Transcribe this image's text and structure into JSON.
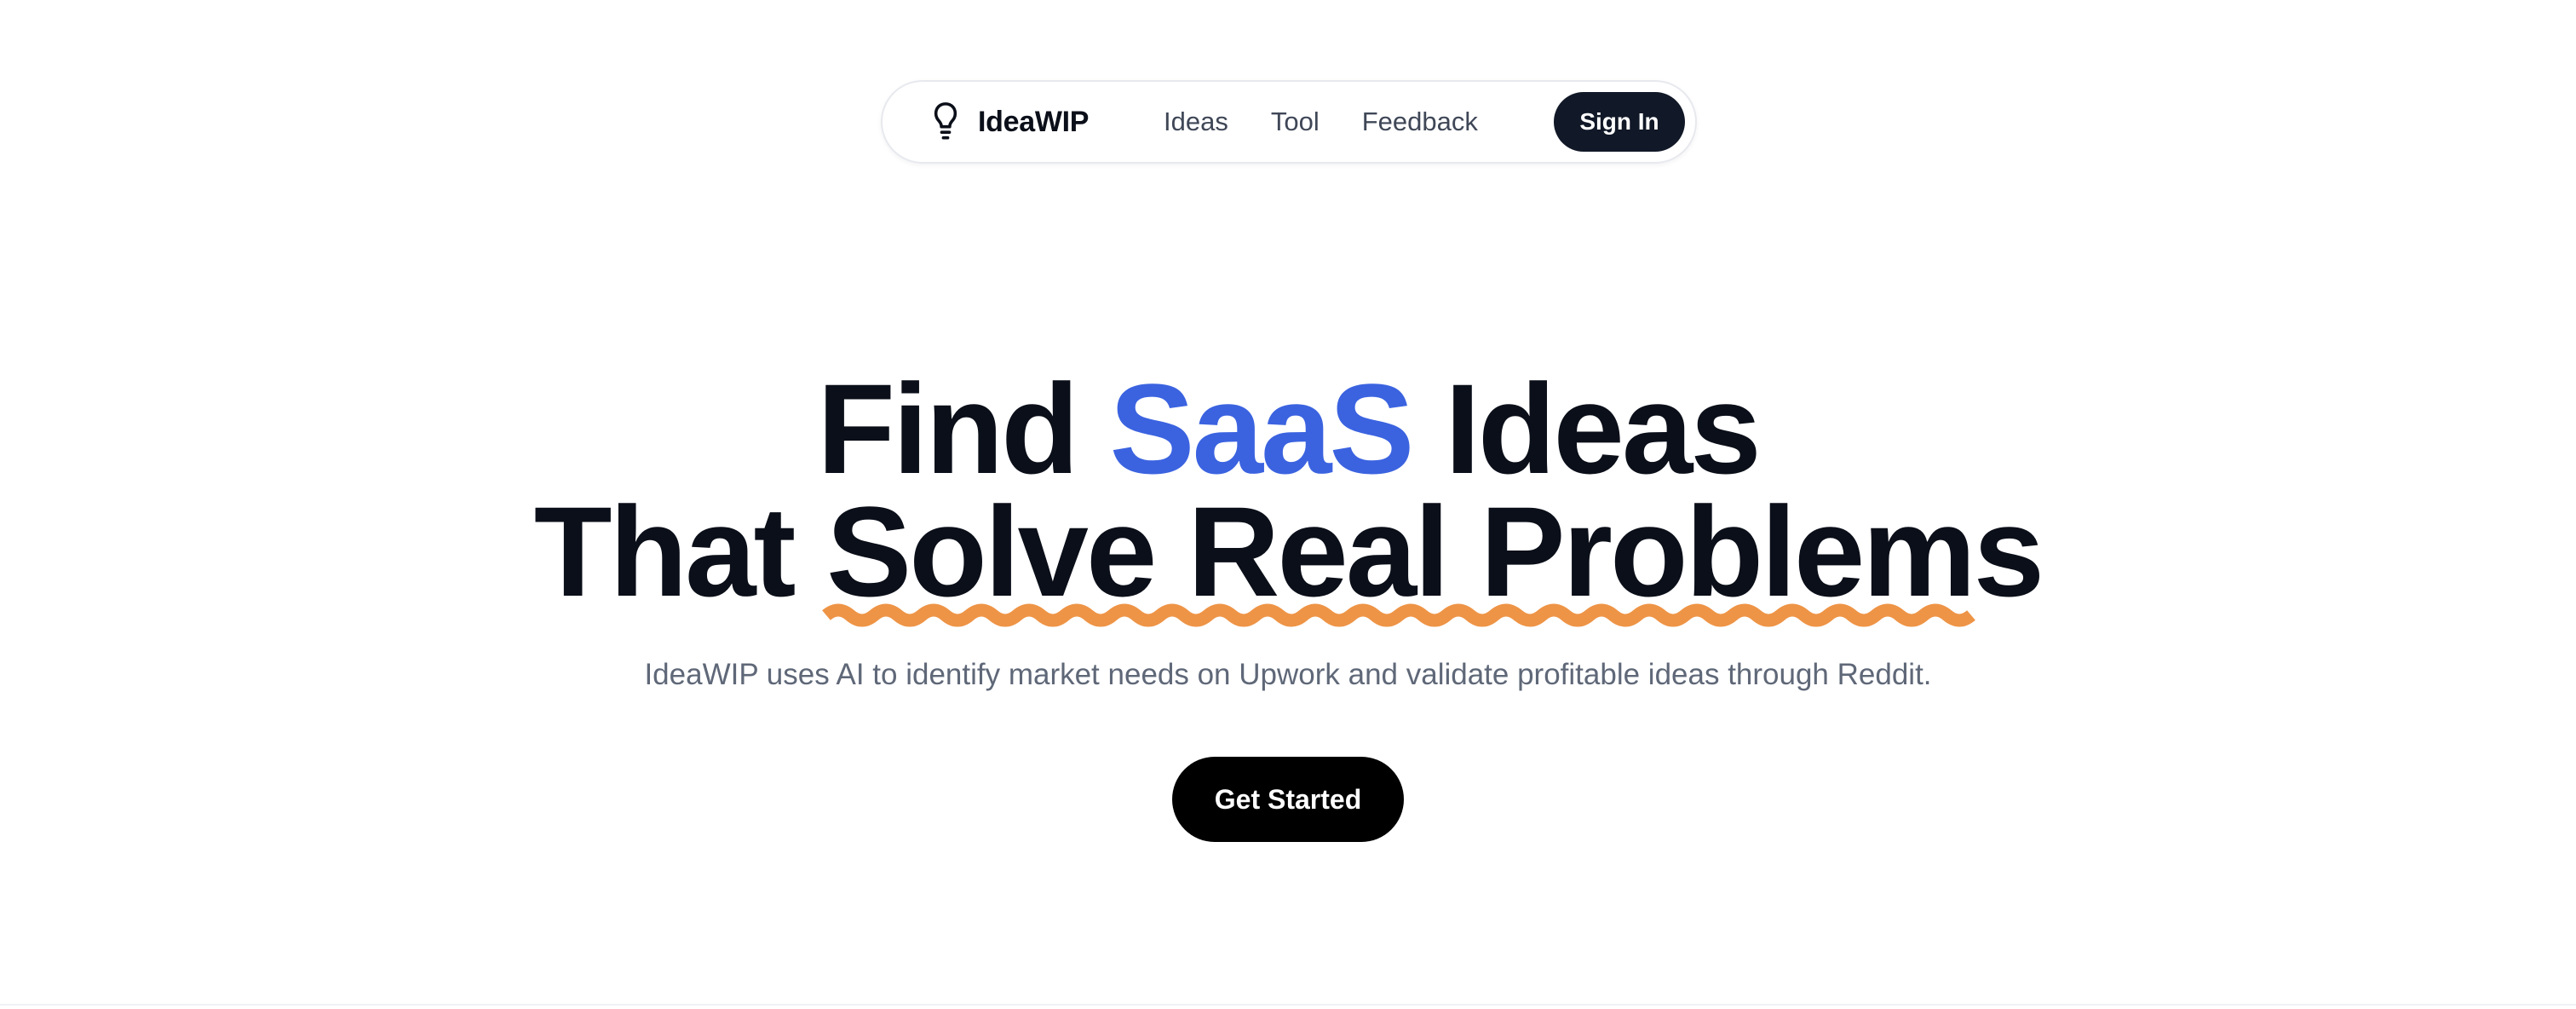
{
  "nav": {
    "brand_name": "IdeaWIP",
    "brand_icon": "lightbulb-icon",
    "links": [
      {
        "label": "Ideas"
      },
      {
        "label": "Tool"
      },
      {
        "label": "Feedback"
      }
    ],
    "signin_label": "Sign In"
  },
  "hero": {
    "line1_part1": "Find",
    "line1_accent": "SaaS",
    "line1_part2": "Ideas",
    "line2_part1": "That",
    "line2_underlined": "Solve Real Problems",
    "subtitle": "IdeaWIP uses AI to identify market needs on Upwork and validate profitable ideas through Reddit.",
    "cta_label": "Get Started"
  },
  "colors": {
    "accent_blue": "#3b63e0",
    "squiggle_orange": "#ee9446",
    "text_dark": "#0b0f19",
    "button_dark": "#111827",
    "cta_black": "#000000",
    "subtitle_gray": "#5f6878"
  }
}
